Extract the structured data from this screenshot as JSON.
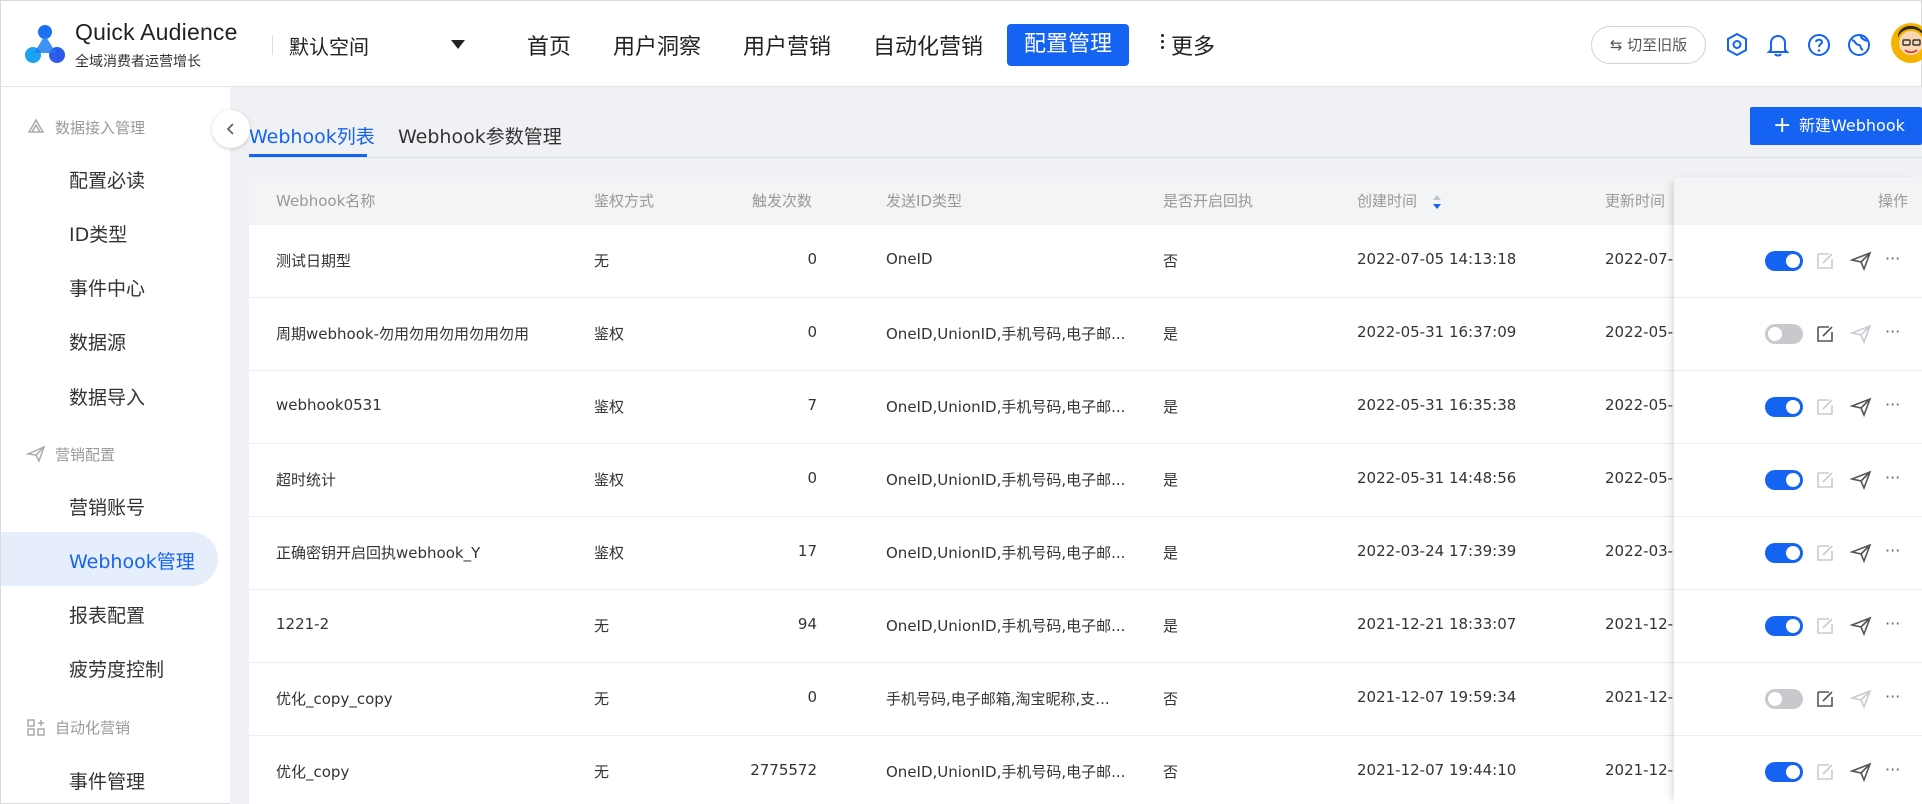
{
  "app": {
    "name": "Quick Audience",
    "subtitle": "全域消费者运营增长",
    "workspace": "默认空间",
    "brand_color": "#1463f3"
  },
  "nav": {
    "items": [
      "首页",
      "用户洞察",
      "用户营销",
      "自动化营销",
      "配置管理"
    ],
    "active": "配置管理",
    "more_label": "更多",
    "switch_old_label": "⇆ 切至旧版",
    "icons": [
      "settings-icon",
      "bell-icon",
      "help-icon",
      "globe-icon",
      "avatar"
    ]
  },
  "sidebar": {
    "groups": [
      {
        "label": "数据接入管理",
        "icon": "data-access-icon",
        "items": [
          "配置必读",
          "ID类型",
          "事件中心",
          "数据源",
          "数据导入"
        ]
      },
      {
        "label": "营销配置",
        "icon": "send-icon",
        "items": [
          "营销账号",
          "Webhook管理",
          "报表配置",
          "疲劳度控制"
        ]
      },
      {
        "label": "自动化营销",
        "icon": "automation-icon",
        "items": [
          "事件管理"
        ]
      }
    ],
    "active_item": "Webhook管理"
  },
  "tabs": {
    "items": [
      "Webhook列表",
      "Webhook参数管理"
    ],
    "active": "Webhook列表"
  },
  "new_button": {
    "label": "新建Webhook"
  },
  "table": {
    "columns": [
      "Webhook名称",
      "鉴权方式",
      "触发次数",
      "发送ID类型",
      "是否开启回执",
      "创建时间",
      "更新时间",
      "操作"
    ],
    "sorted_column": "创建时间",
    "rows": [
      {
        "name": "测试日期型",
        "auth": "无",
        "count": "0",
        "id_types": "OneID",
        "receipt": "否",
        "created": "2022-07-05 14:13:18",
        "updated": "2022-07-",
        "enabled": true
      },
      {
        "name": "周期webhook-勿用勿用勿用勿用勿用",
        "auth": "鉴权",
        "count": "0",
        "id_types": "OneID,UnionID,手机号码,电子邮...",
        "receipt": "是",
        "created": "2022-05-31 16:37:09",
        "updated": "2022-05-",
        "enabled": false
      },
      {
        "name": "webhook0531",
        "auth": "鉴权",
        "count": "7",
        "id_types": "OneID,UnionID,手机号码,电子邮...",
        "receipt": "是",
        "created": "2022-05-31 16:35:38",
        "updated": "2022-05-",
        "enabled": true
      },
      {
        "name": "超时统计",
        "auth": "鉴权",
        "count": "0",
        "id_types": "OneID,UnionID,手机号码,电子邮...",
        "receipt": "是",
        "created": "2022-05-31 14:48:56",
        "updated": "2022-05-",
        "enabled": true
      },
      {
        "name": "正确密钥开启回执webhook_Y",
        "auth": "鉴权",
        "count": "17",
        "id_types": "OneID,UnionID,手机号码,电子邮...",
        "receipt": "是",
        "created": "2022-03-24 17:39:39",
        "updated": "2022-03-",
        "enabled": true
      },
      {
        "name": "1221-2",
        "auth": "无",
        "count": "94",
        "id_types": "OneID,UnionID,手机号码,电子邮...",
        "receipt": "是",
        "created": "2021-12-21 18:33:07",
        "updated": "2021-12-",
        "enabled": true
      },
      {
        "name": "优化_copy_copy",
        "auth": "无",
        "count": "0",
        "id_types": "手机号码,电子邮箱,淘宝昵称,支...",
        "receipt": "否",
        "created": "2021-12-07 19:59:34",
        "updated": "2021-12-",
        "enabled": false
      },
      {
        "name": "优化_copy",
        "auth": "无",
        "count": "2775572",
        "id_types": "OneID,UnionID,手机号码,电子邮...",
        "receipt": "否",
        "created": "2021-12-07 19:44:10",
        "updated": "2021-12-",
        "enabled": true
      }
    ],
    "row_actions": [
      "toggle-switch",
      "edit-icon",
      "send-icon",
      "more-icon"
    ]
  }
}
